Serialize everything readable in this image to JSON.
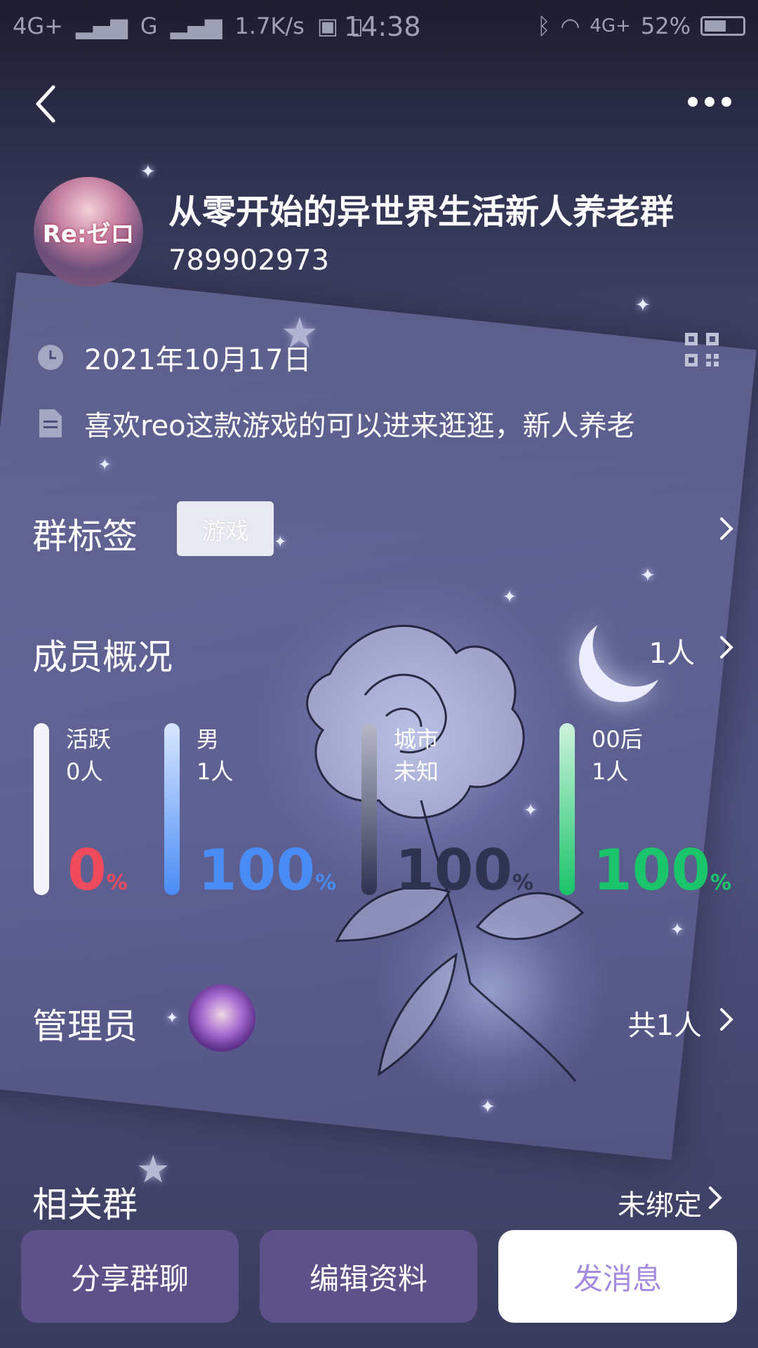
{
  "status_bar": {
    "network1": "4G+",
    "network2": "G",
    "speed": "1.7K/s",
    "time": "14:38",
    "network3": "4G+",
    "battery": "52%"
  },
  "header": {
    "group_name": "从零开始的异世界生活新人养老群",
    "group_id": "789902973",
    "avatar_text": "Re:ゼロ",
    "created_date": "2021年10月17日",
    "description": "喜欢reo这款游戏的可以进来逛逛，新人养老"
  },
  "tags": {
    "title": "群标签",
    "items": [
      "游戏"
    ]
  },
  "members": {
    "title": "成员概况",
    "count": "1人",
    "stats": [
      {
        "label": "活跃",
        "sub": "0人",
        "pct": "0",
        "unit": "%",
        "color": "#f04b5c",
        "bar_fill": 0
      },
      {
        "label": "男",
        "sub": "1人",
        "pct": "100",
        "unit": "%",
        "color": "#4a8cf5",
        "bar_fill": 1
      },
      {
        "label": "城市",
        "sub": "未知",
        "pct": "100",
        "unit": "%",
        "color": "#2f3352",
        "bar_fill": 1
      },
      {
        "label": "00后",
        "sub": "1人",
        "pct": "100",
        "unit": "%",
        "color": "#19c46a",
        "bar_fill": 1
      }
    ]
  },
  "admins": {
    "title": "管理员",
    "total": "共1人"
  },
  "related": {
    "title": "相关群",
    "status": "未绑定"
  },
  "buttons": {
    "share": "分享群聊",
    "edit": "编辑资料",
    "message": "发消息"
  }
}
